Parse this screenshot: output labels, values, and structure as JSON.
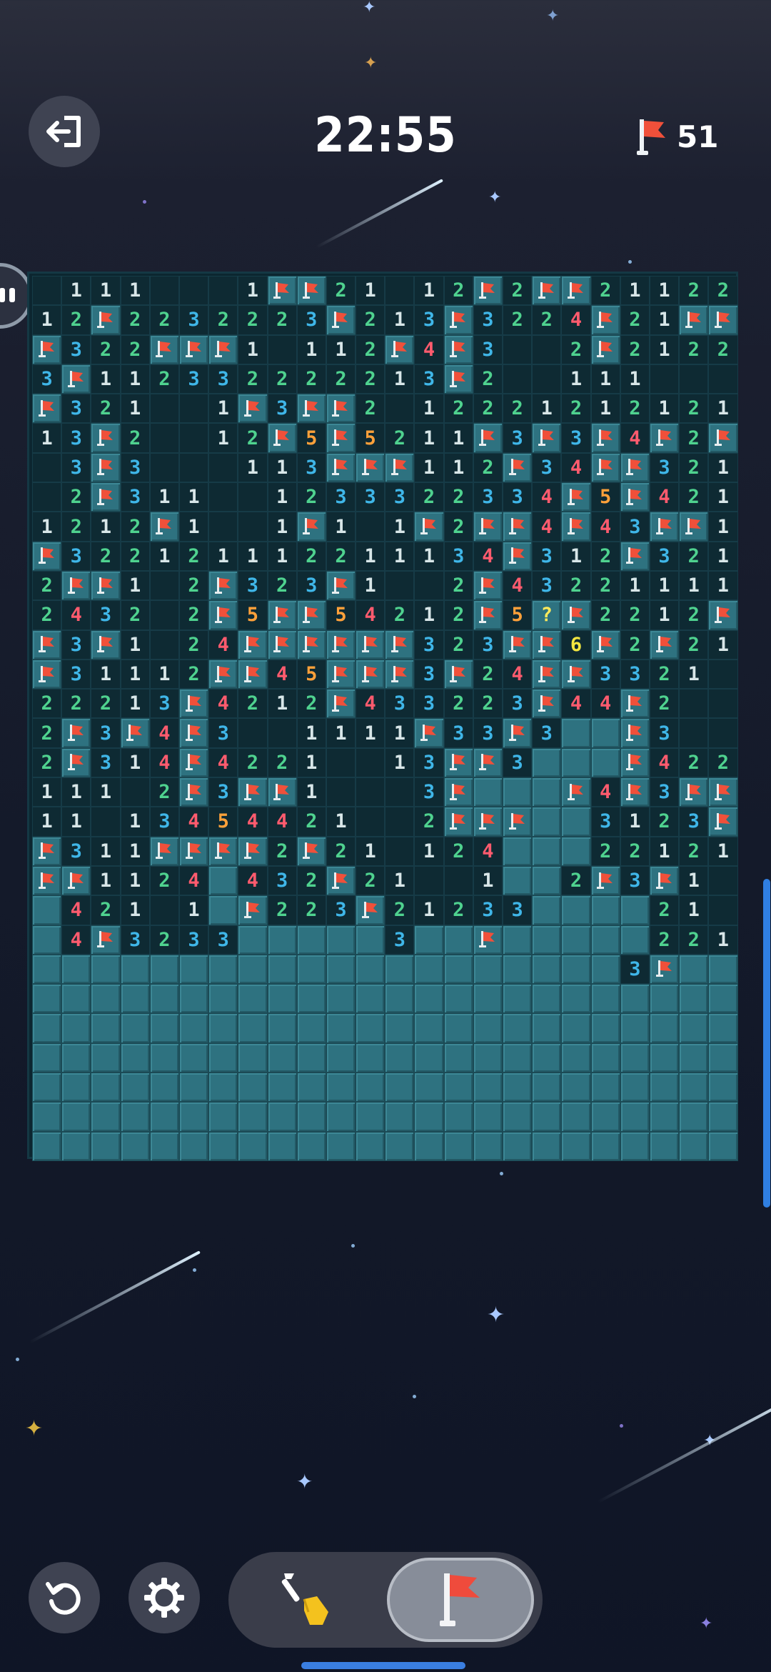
{
  "header": {
    "timer": "22:55",
    "flags_remaining": "51",
    "exit_icon": "exit-door-icon",
    "flag_icon": "flag-icon"
  },
  "board": {
    "columns": 24,
    "rows_total": 30,
    "rows": [
      [
        "",
        "1",
        "1",
        "1",
        "",
        "",
        "",
        "1",
        "F",
        "F",
        "2",
        "1",
        "",
        "1",
        "2",
        "F",
        "2",
        "F",
        "F",
        "2",
        "1",
        "1",
        "2",
        "2"
      ],
      [
        "1",
        "2",
        "F",
        "2",
        "2",
        "3",
        "2",
        "2",
        "2",
        "3",
        "F",
        "2",
        "1",
        "3",
        "F",
        "3",
        "2",
        "2",
        "4",
        "F",
        "2",
        "1",
        "F",
        "F"
      ],
      [
        "F",
        "3",
        "2",
        "2",
        "F",
        "F",
        "F",
        "1",
        "",
        "1",
        "1",
        "2",
        "F",
        "4",
        "F",
        "3",
        "",
        "",
        "2",
        "F",
        "2",
        "1",
        "2",
        "2"
      ],
      [
        "3",
        "F",
        "1",
        "1",
        "2",
        "3",
        "3",
        "2",
        "2",
        "2",
        "2",
        "2",
        "1",
        "3",
        "F",
        "2",
        "",
        "",
        "1",
        "1",
        "1",
        "",
        "",
        ""
      ],
      [
        "F",
        "3",
        "2",
        "1",
        "",
        "",
        "1",
        "F",
        "3",
        "F",
        "F",
        "2",
        "",
        "1",
        "2",
        "2",
        "2",
        "1",
        "2",
        "1",
        "2",
        "1",
        "2",
        "1"
      ],
      [
        "1",
        "3",
        "F",
        "2",
        "",
        "",
        "1",
        "2",
        "F",
        "5",
        "F",
        "5",
        "2",
        "1",
        "1",
        "F",
        "3",
        "F",
        "3",
        "F",
        "4",
        "F",
        "2",
        "F"
      ],
      [
        "",
        "3",
        "F",
        "3",
        "",
        "",
        "",
        "1",
        "1",
        "3",
        "F",
        "F",
        "F",
        "1",
        "1",
        "2",
        "F",
        "3",
        "4",
        "F",
        "F",
        "3",
        "2",
        "1"
      ],
      [
        "",
        "2",
        "F",
        "3",
        "1",
        "1",
        "",
        "",
        "1",
        "2",
        "3",
        "3",
        "3",
        "2",
        "2",
        "3",
        "3",
        "4",
        "F",
        "5",
        "F",
        "4",
        "2",
        "1"
      ],
      [
        "1",
        "2",
        "1",
        "2",
        "F",
        "1",
        "",
        "",
        "1",
        "F",
        "1",
        "",
        "1",
        "F",
        "2",
        "F",
        "F",
        "4",
        "F",
        "4",
        "3",
        "F",
        "F",
        "1"
      ],
      [
        "F",
        "3",
        "2",
        "2",
        "1",
        "2",
        "1",
        "1",
        "1",
        "2",
        "2",
        "1",
        "1",
        "1",
        "3",
        "4",
        "F",
        "3",
        "1",
        "2",
        "F",
        "3",
        "2",
        "1"
      ],
      [
        "2",
        "F",
        "F",
        "1",
        "",
        "2",
        "F",
        "3",
        "2",
        "3",
        "F",
        "1",
        "",
        "",
        "2",
        "F",
        "4",
        "3",
        "2",
        "2",
        "1",
        "1",
        "1",
        "1"
      ],
      [
        "2",
        "4",
        "3",
        "2",
        "",
        "2",
        "F",
        "5",
        "F",
        "F",
        "5",
        "4",
        "2",
        "1",
        "2",
        "F",
        "5",
        "?",
        "F",
        "2",
        "2",
        "1",
        "2",
        "F"
      ],
      [
        "F",
        "3",
        "F",
        "1",
        "",
        "2",
        "4",
        "F",
        "F",
        "F",
        "F",
        "F",
        "F",
        "3",
        "2",
        "3",
        "F",
        "F",
        "6",
        "F",
        "2",
        "F",
        "2",
        "1"
      ],
      [
        "F",
        "3",
        "1",
        "1",
        "1",
        "2",
        "F",
        "F",
        "4",
        "5",
        "F",
        "F",
        "F",
        "3",
        "F",
        "2",
        "4",
        "F",
        "F",
        "3",
        "3",
        "2",
        "1",
        ""
      ],
      [
        "2",
        "2",
        "2",
        "1",
        "3",
        "F",
        "4",
        "2",
        "1",
        "2",
        "F",
        "4",
        "3",
        "3",
        "2",
        "2",
        "3",
        "F",
        "4",
        "4",
        "F",
        "2",
        "",
        ""
      ],
      [
        "2",
        "F",
        "3",
        "F",
        "4",
        "F",
        "3",
        "",
        "",
        "1",
        "1",
        "1",
        "1",
        "F",
        "3",
        "3",
        "F",
        "3",
        "#",
        "#",
        "F",
        "3",
        "",
        ""
      ],
      [
        "2",
        "F",
        "3",
        "1",
        "4",
        "F",
        "4",
        "2",
        "2",
        "1",
        "",
        "",
        "1",
        "3",
        "F",
        "F",
        "3",
        "#",
        "#",
        "#",
        "F",
        "4",
        "2",
        "2"
      ],
      [
        "1",
        "1",
        "1",
        "",
        "2",
        "F",
        "3",
        "F",
        "F",
        "1",
        "",
        "",
        "",
        "3",
        "F",
        "#",
        "#",
        "#",
        "F",
        "4",
        "F",
        "3",
        "F",
        "F"
      ],
      [
        "1",
        "1",
        "",
        "1",
        "3",
        "4",
        "5",
        "4",
        "4",
        "2",
        "1",
        "",
        "",
        "2",
        "F",
        "F",
        "F",
        "#",
        "#",
        "3",
        "1",
        "2",
        "3",
        "F"
      ],
      [
        "F",
        "3",
        "1",
        "1",
        "F",
        "F",
        "F",
        "F",
        "2",
        "F",
        "2",
        "1",
        "",
        "1",
        "2",
        "4",
        "#",
        "#",
        "#",
        "2",
        "2",
        "1",
        "2",
        "1"
      ],
      [
        "F",
        "F",
        "1",
        "1",
        "2",
        "4",
        "#",
        "4",
        "3",
        "2",
        "F",
        "2",
        "1",
        "",
        "",
        "1",
        "#",
        "#",
        "2",
        "F",
        "3",
        "F",
        "1",
        ""
      ],
      [
        "#",
        "4",
        "2",
        "1",
        "",
        "1",
        "#",
        "F",
        "2",
        "2",
        "3",
        "F",
        "2",
        "1",
        "2",
        "3",
        "3",
        "#",
        "#",
        "#",
        "#",
        "2",
        "1",
        ""
      ],
      [
        "#",
        "4",
        "F",
        "3",
        "2",
        "3",
        "3",
        "#",
        "#",
        "#",
        "#",
        "#",
        "3",
        "#",
        "#",
        "F",
        "#",
        "#",
        "#",
        "#",
        "#",
        "2",
        "2",
        "1"
      ],
      [
        "#",
        "#",
        "#",
        "#",
        "#",
        "#",
        "#",
        "#",
        "#",
        "#",
        "#",
        "#",
        "#",
        "#",
        "#",
        "#",
        "#",
        "#",
        "#",
        "#",
        "3",
        "F",
        "#",
        "#"
      ]
    ]
  },
  "toolbar": {
    "restart_icon": "restart-icon",
    "settings_icon": "gear-icon",
    "dig_icon": "shovel-icon",
    "flag_mode_icon": "flag-icon",
    "active_mode": "flag"
  },
  "colors": {
    "n1": "#d8e6e8",
    "n2": "#4fd28f",
    "n3": "#3fb6e8",
    "n4": "#ff5b6e",
    "n5": "#ffa13a",
    "n6": "#f2e640",
    "flag": "#f0503a",
    "covered": "#2e7280",
    "accent": "#2f7fe2"
  }
}
